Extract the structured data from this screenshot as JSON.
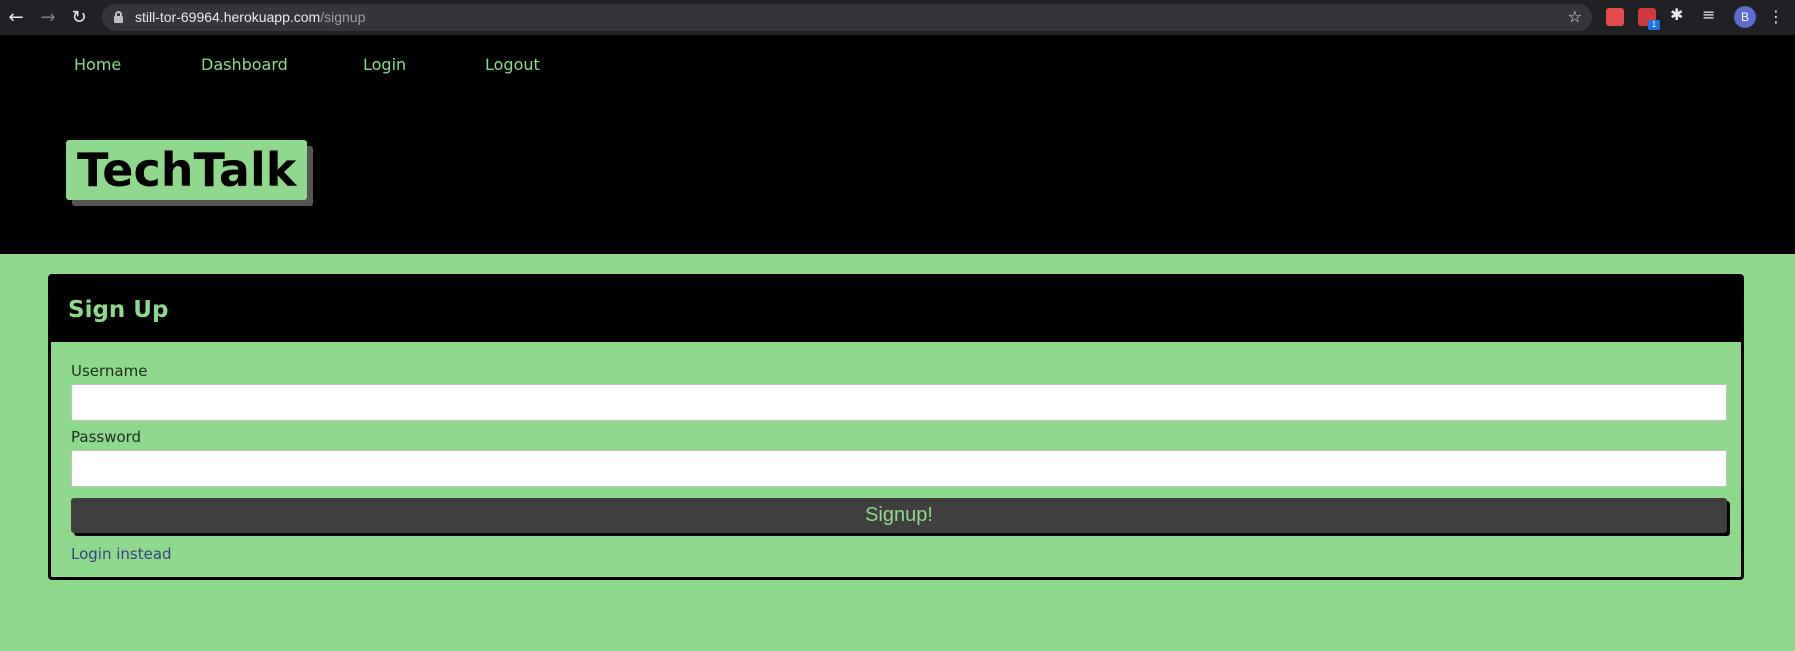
{
  "browser": {
    "url_host": "still-tor-69964.herokuapp.com",
    "url_path": "/signup",
    "profile_initial": "B",
    "extension_badge": "1",
    "icons": [
      "back-arrow-icon",
      "forward-arrow-icon",
      "reload-icon",
      "lock-icon",
      "star-icon",
      "extension-icon",
      "puzzle-icon",
      "media-queue-icon",
      "kebab-menu-icon"
    ]
  },
  "nav": {
    "items": [
      {
        "label": "Home"
      },
      {
        "label": "Dashboard"
      },
      {
        "label": "Login"
      },
      {
        "label": "Logout"
      }
    ]
  },
  "brand": {
    "title": "TechTalk"
  },
  "signup": {
    "title": "Sign Up",
    "username_label": "Username",
    "username_value": "",
    "password_label": "Password",
    "password_value": "",
    "submit_label": "Signup!",
    "alt_link": "Login instead"
  },
  "colors": {
    "accent_green": "#8fd98c",
    "header_bg": "#000000",
    "button_bg": "#3f3f3f",
    "link": "#3d3f85"
  }
}
